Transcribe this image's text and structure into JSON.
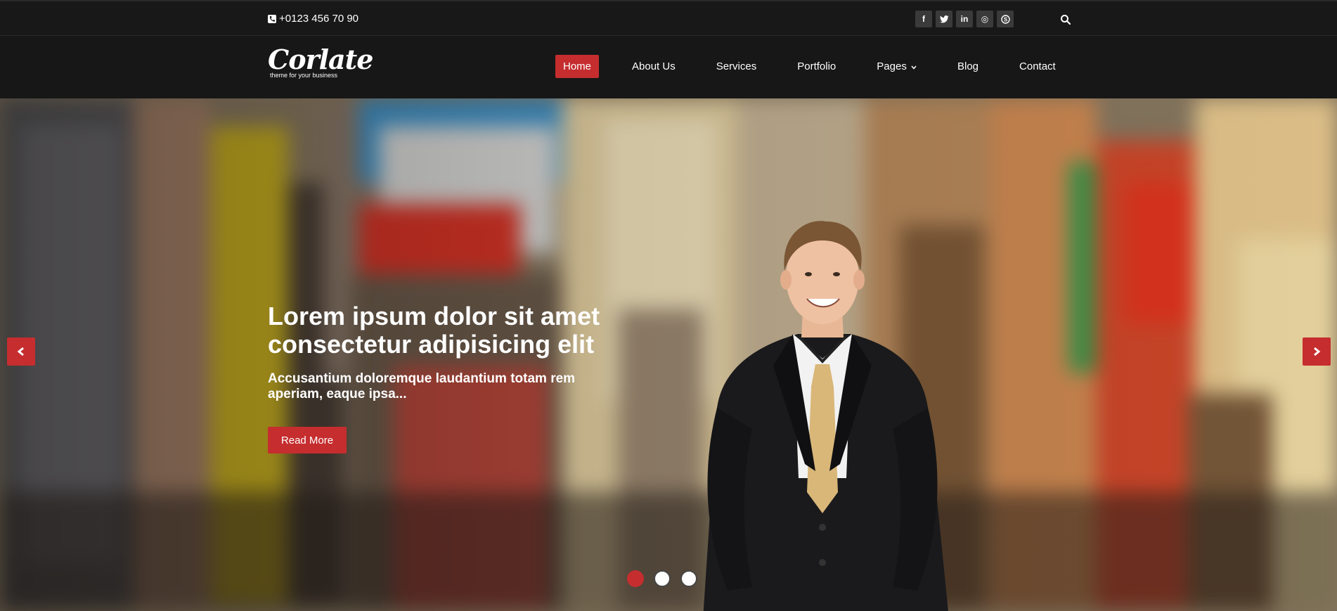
{
  "topbar": {
    "phone": "+0123 456 70 90",
    "socials": [
      {
        "icon": "facebook-icon",
        "glyph": "f"
      },
      {
        "icon": "twitter-icon",
        "glyph": "t"
      },
      {
        "icon": "linkedin-icon",
        "glyph": "in"
      },
      {
        "icon": "dribbble-icon",
        "glyph": "◎"
      },
      {
        "icon": "skype-icon",
        "glyph": "S"
      }
    ],
    "search_icon": "search-icon"
  },
  "brand": {
    "name": "Corlate",
    "tagline": "theme for your business"
  },
  "nav": {
    "items": [
      {
        "label": "Home",
        "active": true
      },
      {
        "label": "About Us",
        "active": false
      },
      {
        "label": "Services",
        "active": false
      },
      {
        "label": "Portfolio",
        "active": false
      },
      {
        "label": "Pages",
        "active": false,
        "dropdown": true
      },
      {
        "label": "Blog",
        "active": false
      },
      {
        "label": "Contact",
        "active": false
      }
    ]
  },
  "hero": {
    "title": "Lorem ipsum dolor sit amet consectetur adipisicing elit",
    "subtitle": "Accusantium doloremque laudantium totam rem aperiam, eaque ipsa...",
    "button_label": "Read More",
    "prev_icon": "chevron-left-icon",
    "next_icon": "chevron-right-icon",
    "slides": 3,
    "active_slide": 1
  },
  "colors": {
    "accent": "#c52d2f",
    "topbar_bg": "#181818",
    "navbar_bg": "#171717"
  }
}
